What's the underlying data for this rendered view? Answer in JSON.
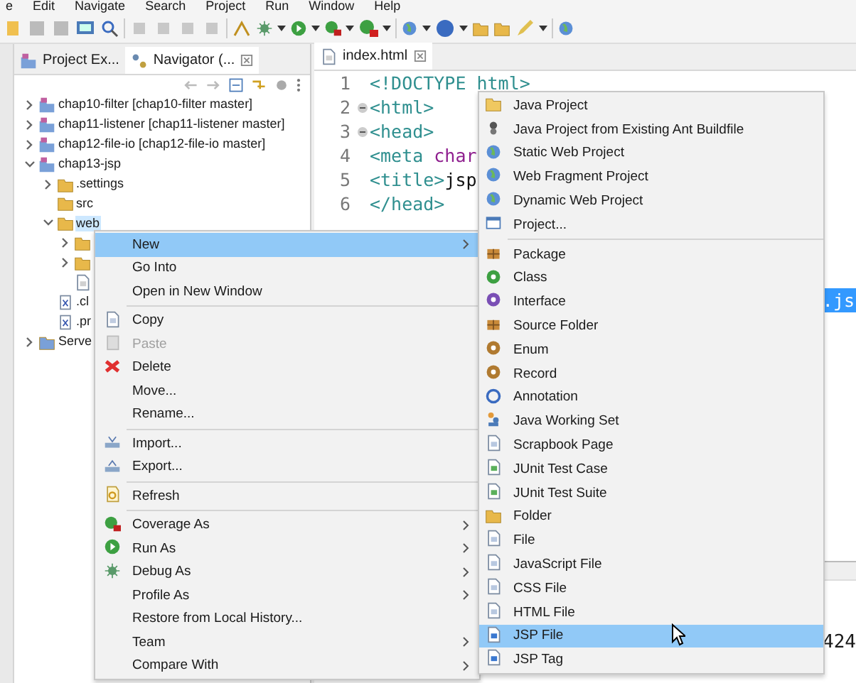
{
  "menubar": [
    "e",
    "Edit",
    "Navigate",
    "Search",
    "Project",
    "Run",
    "Window",
    "Help"
  ],
  "left_panel": {
    "tabs": [
      {
        "label": "Project Ex...",
        "selected": false,
        "kind": "project"
      },
      {
        "label": "Navigator (...",
        "selected": true,
        "kind": "navigator"
      }
    ],
    "tree": [
      {
        "label": "chap10-filter [chap10-filter master]",
        "kind": "project",
        "expanded": false,
        "selected": false
      },
      {
        "label": "chap11-listener [chap11-listener master]",
        "kind": "project",
        "expanded": false,
        "selected": false
      },
      {
        "label": "chap12-file-io [chap12-file-io master]",
        "kind": "project",
        "expanded": false,
        "selected": false
      },
      {
        "label": "chap13-jsp",
        "kind": "project",
        "expanded": true,
        "selected": false,
        "children": [
          {
            "label": ".settings",
            "kind": "folder",
            "expanded": false,
            "selected": false
          },
          {
            "label": "src",
            "kind": "folder",
            "selected": false
          },
          {
            "label": "web",
            "kind": "folder",
            "expanded": true,
            "selected": true,
            "children": [
              {
                "kind": "folder",
                "expanded": false
              },
              {
                "kind": "folder",
                "expanded": false
              },
              {
                "kind": "file"
              }
            ]
          },
          {
            "label": ".cl",
            "kind": "xml",
            "selected": false
          },
          {
            "label": ".pr",
            "kind": "xml",
            "selected": false
          }
        ]
      },
      {
        "label": "Serve",
        "kind": "server",
        "expanded": false,
        "selected": false
      }
    ]
  },
  "editor": {
    "tab": "index.html",
    "lines": [
      {
        "number": "1",
        "fold": false,
        "segments": [
          {
            "text": "<!DOCTYPE html>",
            "kind": "tag"
          }
        ]
      },
      {
        "number": "2",
        "fold": true,
        "segments": [
          {
            "text": "<html>",
            "kind": "tag"
          }
        ]
      },
      {
        "number": "3",
        "fold": true,
        "segments": [
          {
            "text": "<head>",
            "kind": "tag"
          }
        ]
      },
      {
        "number": "4",
        "fold": false,
        "segments": [
          {
            "text": "<meta ",
            "kind": "tag"
          },
          {
            "text": "char",
            "kind": "attr"
          }
        ]
      },
      {
        "number": "5",
        "fold": false,
        "segments": [
          {
            "text": "<title>",
            "kind": "tag"
          },
          {
            "text": "jsp",
            "kind": "text"
          }
        ]
      },
      {
        "number": "6",
        "fold": false,
        "segments": [
          {
            "text": "</head>",
            "kind": "tag"
          }
        ]
      }
    ],
    "selection": ".js"
  },
  "bottom_panel": {
    "text": "424"
  },
  "context_menu": [
    {
      "kind": "plain",
      "label": "New",
      "submenu": true,
      "selected": true,
      "disabled": false
    },
    {
      "kind": "plain",
      "label": "Go Into",
      "submenu": false,
      "selected": false,
      "disabled": false
    },
    {
      "kind": "plain",
      "label": "Open in New Window",
      "submenu": false,
      "selected": false,
      "disabled": false
    },
    {
      "kind": "separator"
    },
    {
      "kind": "copy",
      "label": "Copy",
      "submenu": false,
      "selected": false,
      "disabled": false
    },
    {
      "kind": "paste",
      "label": "Paste",
      "submenu": false,
      "selected": false,
      "disabled": true
    },
    {
      "kind": "delete",
      "label": "Delete",
      "submenu": false,
      "selected": false,
      "disabled": false
    },
    {
      "kind": "plain",
      "label": "Move...",
      "submenu": false,
      "selected": false,
      "disabled": false
    },
    {
      "kind": "plain",
      "label": "Rename...",
      "submenu": false,
      "selected": false,
      "disabled": false
    },
    {
      "kind": "separator"
    },
    {
      "kind": "import",
      "label": "Import...",
      "submenu": false,
      "selected": false,
      "disabled": false
    },
    {
      "kind": "export",
      "label": "Export...",
      "submenu": false,
      "selected": false,
      "disabled": false
    },
    {
      "kind": "separator"
    },
    {
      "kind": "refresh",
      "label": "Refresh",
      "submenu": false,
      "selected": false,
      "disabled": false
    },
    {
      "kind": "separator"
    },
    {
      "kind": "coverage",
      "label": "Coverage As",
      "submenu": true,
      "selected": false,
      "disabled": false
    },
    {
      "kind": "run",
      "label": "Run As",
      "submenu": true,
      "selected": false,
      "disabled": false
    },
    {
      "kind": "debug",
      "label": "Debug As",
      "submenu": true,
      "selected": false,
      "disabled": false
    },
    {
      "kind": "plain",
      "label": "Profile As",
      "submenu": true,
      "selected": false,
      "disabled": false
    },
    {
      "kind": "plain",
      "label": "Restore from Local History...",
      "submenu": false,
      "selected": false,
      "disabled": false
    },
    {
      "kind": "plain",
      "label": "Team",
      "submenu": true,
      "selected": false,
      "disabled": false
    },
    {
      "kind": "plain",
      "label": "Compare With",
      "submenu": true,
      "selected": false,
      "disabled": false
    }
  ],
  "submenu": [
    {
      "kind": "java-project",
      "label": "Java Project",
      "selected": false
    },
    {
      "kind": "ant",
      "label": "Java Project from Existing Ant Buildfile",
      "selected": false
    },
    {
      "kind": "globe",
      "label": "Static Web Project",
      "selected": false
    },
    {
      "kind": "globe",
      "label": "Web Fragment Project",
      "selected": false
    },
    {
      "kind": "globe",
      "label": "Dynamic Web Project",
      "selected": false
    },
    {
      "kind": "window",
      "label": "Project...",
      "selected": false
    },
    {
      "kind": "separator"
    },
    {
      "kind": "package",
      "label": "Package",
      "selected": false
    },
    {
      "kind": "class",
      "label": "Class",
      "selected": false
    },
    {
      "kind": "interface",
      "label": "Interface",
      "selected": false
    },
    {
      "kind": "package",
      "label": "Source Folder",
      "selected": false
    },
    {
      "kind": "enum",
      "label": "Enum",
      "selected": false
    },
    {
      "kind": "enum",
      "label": "Record",
      "selected": false
    },
    {
      "kind": "annotation",
      "label": "Annotation",
      "selected": false
    },
    {
      "kind": "people",
      "label": "Java Working Set",
      "selected": false
    },
    {
      "kind": "document",
      "label": "Scrapbook Page",
      "selected": false
    },
    {
      "kind": "junit",
      "label": "JUnit Test Case",
      "selected": false
    },
    {
      "kind": "junit",
      "label": "JUnit Test Suite",
      "selected": false
    },
    {
      "kind": "folder",
      "label": "Folder",
      "selected": false
    },
    {
      "kind": "document",
      "label": "File",
      "selected": false
    },
    {
      "kind": "document",
      "label": "JavaScript File",
      "selected": false
    },
    {
      "kind": "document",
      "label": "CSS File",
      "selected": false
    },
    {
      "kind": "document",
      "label": "HTML File",
      "selected": false
    },
    {
      "kind": "jsp",
      "label": "JSP File",
      "selected": true
    },
    {
      "kind": "jsp",
      "label": "JSP Tag",
      "selected": false
    }
  ]
}
